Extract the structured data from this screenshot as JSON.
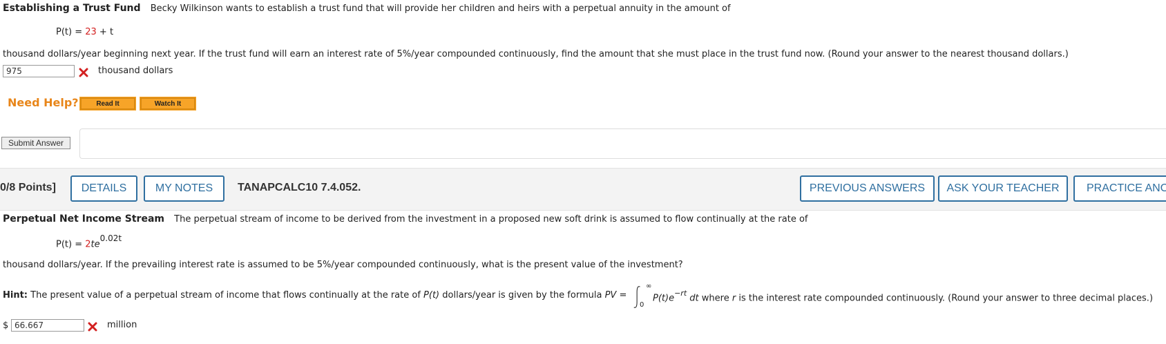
{
  "q1": {
    "title": "Establishing a Trust Fund",
    "intro": "Becky Wilkinson wants to establish a trust fund that will provide her children and heirs with a perpetual annuity in the amount of",
    "formula_lhs": "P(t) = ",
    "formula_const": "23",
    "formula_rest": " + t",
    "body": "thousand dollars/year beginning next year. If the trust fund will earn an interest rate of 5%/year compounded continuously, find the amount that she must place in the trust fund now. (Round your answer to the nearest thousand dollars.)",
    "answer_value": "975",
    "unit": "thousand dollars"
  },
  "help": {
    "label": "Need Help?",
    "read_it": "Read It",
    "watch_it": "Watch It"
  },
  "submit_label": "Submit Answer",
  "bar": {
    "points": "0/8 Points]",
    "details": "DETAILS",
    "my_notes": "MY NOTES",
    "question_id": "TANAPCALC10 7.4.052.",
    "previous_answers": "PREVIOUS ANSWERS",
    "ask_teacher": "ASK YOUR TEACHER",
    "practice": "PRACTICE ANOT"
  },
  "q2": {
    "title": "Perpetual Net Income Stream",
    "intro": "The perpetual stream of income to be derived from the investment in a proposed new soft drink is assumed to flow continually at the rate of",
    "formula_lhs": "P(t) = ",
    "formula_coef": "2",
    "formula_var": "te",
    "formula_exp": "0.02t",
    "body": "thousand dollars/year. If the prevailing interest rate is assumed to be 5%/year compounded continuously, what is the present value of the investment?",
    "hint_label": "Hint:",
    "hint_text1": "The present value of a perpetual stream of income that flows continually at the rate of",
    "hint_pt": "P(t)",
    "hint_text2": "dollars/year is given by the formula",
    "hint_pv": "PV =",
    "int_upper": "∞",
    "int_lower": "0",
    "integrand": "P(t)e",
    "integrand_exp": "−rt",
    "dt": "dt",
    "hint_text3": "where",
    "hint_r": "r",
    "hint_text4": "is the interest rate compounded continuously. (Round your answer to three decimal places.)",
    "currency": "$",
    "answer_value": "66.667",
    "unit": "million"
  },
  "colors": {
    "accent_blue": "#2f6fa0",
    "help_orange": "#e8861a",
    "error_red": "#d32020"
  }
}
